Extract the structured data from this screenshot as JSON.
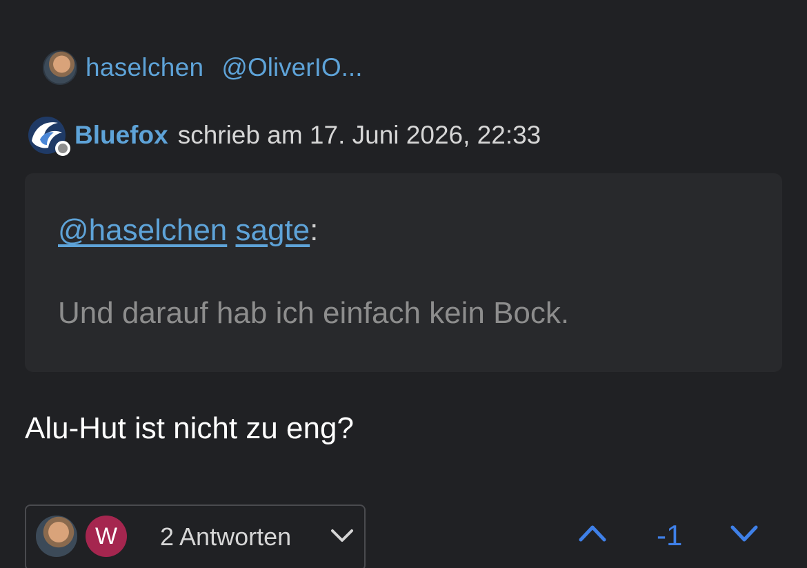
{
  "reply_to": {
    "username": "haselchen",
    "mention": "@OliverIO..."
  },
  "author": {
    "name": "Bluefox",
    "meta": "schrieb am 17. Juni 2026, 22:33"
  },
  "quote": {
    "mention": "@haselchen",
    "said_link": "sagte",
    "colon": ":",
    "text": "Und darauf hab ich einfach kein Bock."
  },
  "post": {
    "body": "Alu-Hut ist nicht zu eng?"
  },
  "replies": {
    "avatar2_letter": "W",
    "label": "2 Antworten"
  },
  "votes": {
    "count": "-1"
  },
  "colors": {
    "background": "#202124",
    "link": "#5ea3d8",
    "vote_accent": "#3f80e8",
    "avatar_w": "#a5264f"
  }
}
